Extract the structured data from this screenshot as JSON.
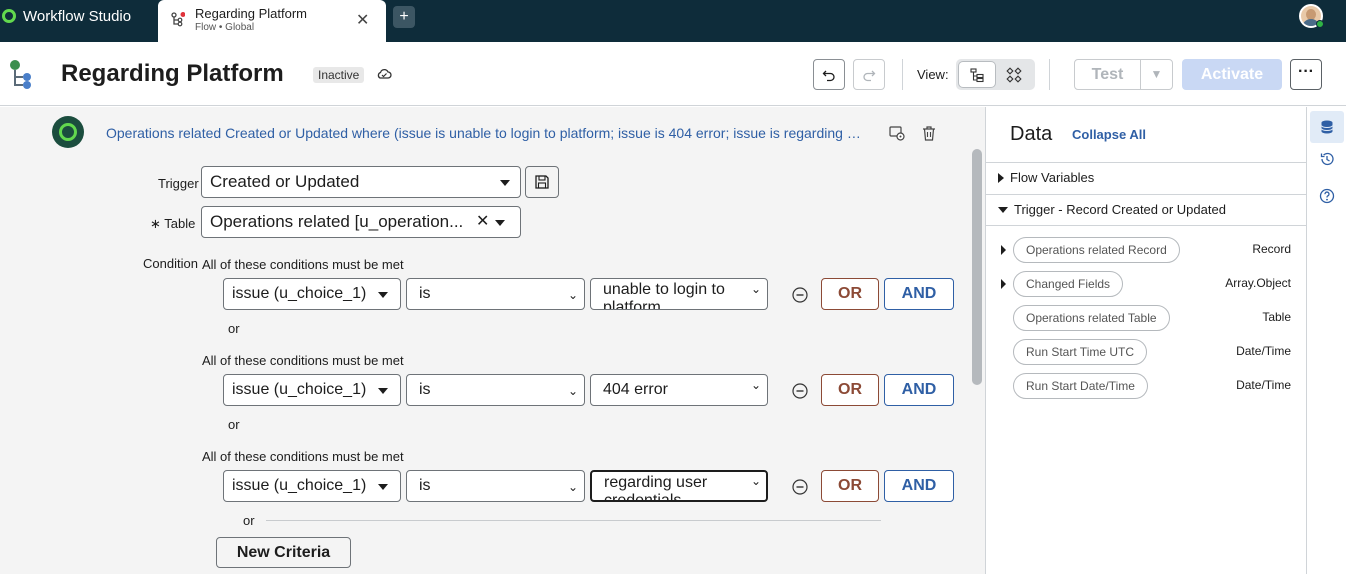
{
  "app": {
    "title": "Workflow Studio"
  },
  "tab": {
    "title": "Regarding Platform",
    "subtitle": "Flow • Global",
    "close_glyph": "✕"
  },
  "new_tab_glyph": "+",
  "header": {
    "title": "Regarding Platform",
    "status": "Inactive",
    "view_label": "View:",
    "test_label": "Test",
    "activate_label": "Activate",
    "more_glyph": "···"
  },
  "trigger": {
    "summary": "Operations related Created or Updated where (issue is unable to login to platform; issue is 404 error; issue is regarding user",
    "trigger_label": "Trigger",
    "trigger_value": "Created or Updated",
    "table_label": "∗ Table",
    "table_value": "Operations related [u_operation...",
    "table_clear_glyph": "✕",
    "condition_label": "Condition"
  },
  "conditions": [
    {
      "heading": "All of these conditions must be met",
      "field": "issue (u_choice_1)",
      "operator": "is",
      "value": "unable to login to platform",
      "or_label": "OR",
      "and_label": "AND",
      "separator": "or"
    },
    {
      "heading": "All of these conditions must be met",
      "field": "issue (u_choice_1)",
      "operator": "is",
      "value": "404 error",
      "or_label": "OR",
      "and_label": "AND",
      "separator": "or"
    },
    {
      "heading": "All of these conditions must be met",
      "field": "issue (u_choice_1)",
      "operator": "is",
      "value": "regarding user credentials",
      "or_label": "OR",
      "and_label": "AND",
      "separator": "or"
    }
  ],
  "new_criteria_label": "New Criteria",
  "data_panel": {
    "title": "Data",
    "collapse_label": "Collapse All",
    "flow_variables": "Flow Variables",
    "trigger_section": "Trigger - Record Created or Updated",
    "pills": [
      {
        "label": "Operations related Record",
        "type": "Record",
        "expandable": true
      },
      {
        "label": "Changed Fields",
        "type": "Array.Object",
        "expandable": true
      },
      {
        "label": "Operations related Table",
        "type": "Table",
        "expandable": false
      },
      {
        "label": "Run Start Time UTC",
        "type": "Date/Time",
        "expandable": false
      },
      {
        "label": "Run Start Date/Time",
        "type": "Date/Time",
        "expandable": false
      }
    ]
  },
  "rail": {
    "icons": [
      "database-icon",
      "history-icon",
      "help-icon"
    ]
  },
  "colors": {
    "topbar": "#0e2c3a",
    "brand_green": "#62d84e",
    "link_blue": "#2f5fa5",
    "or_brown": "#8c4a36",
    "activate_disabled": "#c9d8f4"
  }
}
